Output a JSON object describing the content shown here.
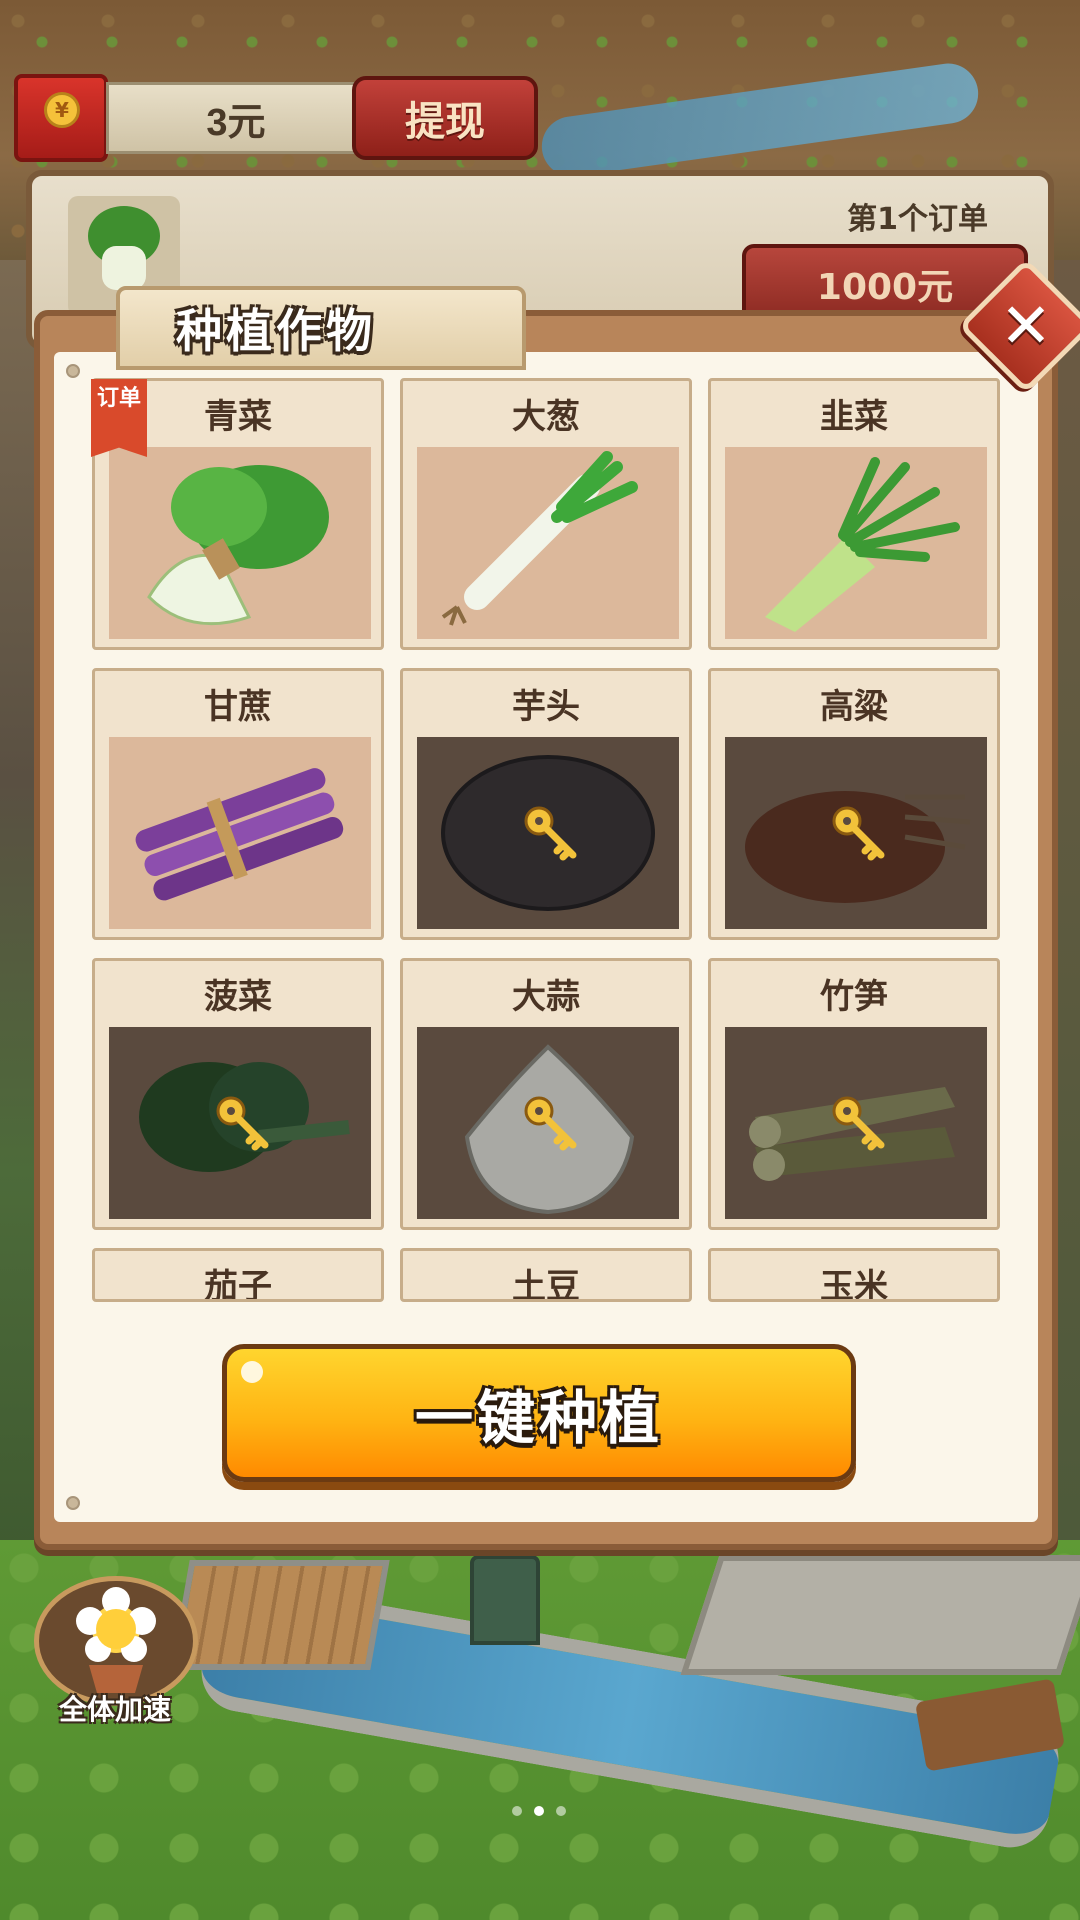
{
  "hud": {
    "balance": "3元",
    "withdraw_label": "提现",
    "coin_symbol": "¥"
  },
  "order": {
    "title": "第1个订单",
    "reward": "1000元"
  },
  "modal": {
    "title": "种植作物",
    "close_symbol": "✕",
    "order_badge": "订单",
    "crops": [
      {
        "name": "青菜",
        "locked": false,
        "icon": "bok-choy-icon",
        "order": true
      },
      {
        "name": "大葱",
        "locked": false,
        "icon": "scallion-icon",
        "order": false
      },
      {
        "name": "韭菜",
        "locked": false,
        "icon": "chives-icon",
        "order": false
      },
      {
        "name": "甘蔗",
        "locked": false,
        "icon": "sugarcane-icon",
        "order": false
      },
      {
        "name": "芋头",
        "locked": true,
        "icon": "taro-icon",
        "order": false
      },
      {
        "name": "高粱",
        "locked": true,
        "icon": "sorghum-icon",
        "order": false
      },
      {
        "name": "菠菜",
        "locked": true,
        "icon": "spinach-icon",
        "order": false
      },
      {
        "name": "大蒜",
        "locked": true,
        "icon": "garlic-icon",
        "order": false
      },
      {
        "name": "竹笋",
        "locked": true,
        "icon": "bamboo-shoot-icon",
        "order": false
      },
      {
        "name": "茄子",
        "locked": true,
        "icon": "eggplant-icon",
        "order": false
      },
      {
        "name": "土豆",
        "locked": true,
        "icon": "potato-icon",
        "order": false
      },
      {
        "name": "玉米",
        "locked": true,
        "icon": "corn-icon",
        "order": false
      }
    ],
    "plant_all_label": "一键种植"
  },
  "boost": {
    "label": "全体加速"
  },
  "colors": {
    "accent_yellow": "#ffb413",
    "danger_red": "#c2413a",
    "panel_bg": "#fbf6ea",
    "locked_tile": "#5a4a3e",
    "unlocked_tile": "#dcb89b"
  }
}
